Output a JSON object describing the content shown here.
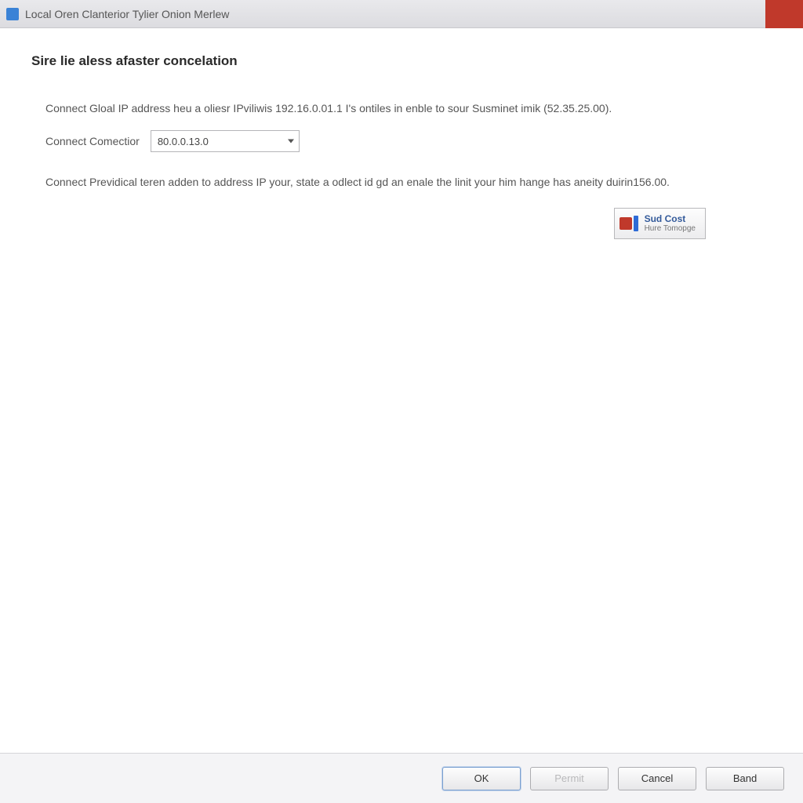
{
  "window": {
    "title": "Local Oren Clanterior Tylier Onion Merlew"
  },
  "page": {
    "heading": "Sire lie aless afaster concelation",
    "paragraph1": "Connect Gloal IP address heu a oliesr IPviliwis 192.16.0.01.1 I's ontiles in enble to sour Susminet imik (52.35.25.00).",
    "connectorLabel": "Connect Comectior",
    "connectorValue": "80.0.0.13.0",
    "paragraph2": "Connect Previdical teren adden to address IP your, state a odlect id gd an enale the linit your him hange has aneity duirin156.00.",
    "shieldTitle": "Sud Cost",
    "shieldSub": "Hure Tomopge"
  },
  "footer": {
    "ok": "OK",
    "permit": "Permit",
    "cancel": "Cancel",
    "band": "Band"
  }
}
